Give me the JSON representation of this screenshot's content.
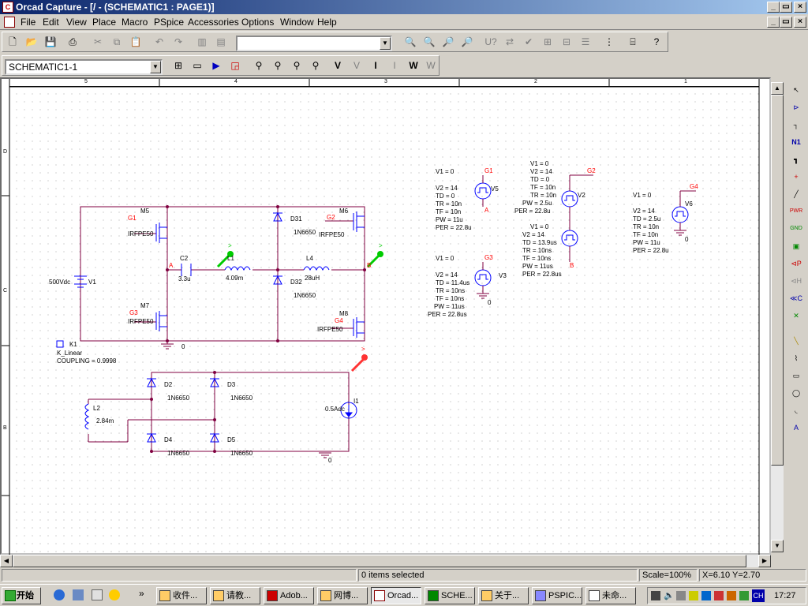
{
  "window": {
    "title": "Orcad Capture - [/ - (SCHEMATIC1 : PAGE1)]",
    "app_icon": "orcad-icon"
  },
  "menu": [
    "File",
    "Edit",
    "View",
    "Place",
    "Macro",
    "PSpice",
    "Accessories",
    "Options",
    "Window",
    "Help"
  ],
  "toolbar": {
    "part_combo_value": "",
    "schematic_combo_value": "SCHEMATIC1-1"
  },
  "ruler": [
    "5",
    "4",
    "3",
    "2",
    "1"
  ],
  "side_letters": [
    "D",
    "C",
    "B"
  ],
  "schematic": {
    "transistors": [
      {
        "ref": "M5",
        "part": "IRFPE50",
        "gate": "G1"
      },
      {
        "ref": "M6",
        "part": "IRFPE50",
        "gate": "G2"
      },
      {
        "ref": "M7",
        "part": "IRFPE50",
        "gate": "G3"
      },
      {
        "ref": "M8",
        "part": "IRFPE50",
        "gate": "G4"
      }
    ],
    "diodes": [
      {
        "ref": "D31",
        "part": "1N6650"
      },
      {
        "ref": "D32",
        "part": "1N6650"
      },
      {
        "ref": "D2",
        "part": "1N6650"
      },
      {
        "ref": "D3",
        "part": "1N6650"
      },
      {
        "ref": "D4",
        "part": "1N6650"
      },
      {
        "ref": "D5",
        "part": "1N6650"
      }
    ],
    "passives": [
      {
        "ref": "C2",
        "value": "3.3u"
      },
      {
        "ref": "L1",
        "value": "4.09m"
      },
      {
        "ref": "L4",
        "value": "28uH"
      },
      {
        "ref": "L2",
        "value": "2.84m"
      }
    ],
    "source_v1": {
      "ref": "V1",
      "value": "500Vdc"
    },
    "source_i1": {
      "ref": "I1",
      "value": "0.5Adc"
    },
    "coupling": {
      "ref": "K1",
      "model": "K_Linear",
      "text": "COUPLING = 0.9998"
    },
    "nodes": [
      "A",
      "B"
    ],
    "grounds": [
      "0",
      "0",
      "0",
      "0",
      "0"
    ],
    "pulses": [
      {
        "ref": "V5",
        "net": "G1",
        "lines": [
          "V1 = 0",
          "V2 = 14",
          "TD = 0",
          "TR = 10n",
          "TF = 10n",
          "PW = 11u",
          "PER = 22.8u"
        ],
        "bottom": "A"
      },
      {
        "ref": "V3",
        "net": "G3",
        "lines": [
          "V1 = 0",
          "V2 = 14",
          "TD = 11.4us",
          "TR = 10ns",
          "TF = 10ns",
          "PW = 11us",
          "PER = 22.8us"
        ],
        "bottom": "0"
      },
      {
        "ref": "V2",
        "net": "G2",
        "lines": [
          "V1 = 0",
          "V2 = 14",
          "TD = 0",
          "TF = 10n",
          "TR = 10n",
          "PW = 2.5u",
          "PER = 22.8u"
        ]
      },
      {
        "ref": "",
        "net": "B",
        "lines": [
          "V1 = 0",
          "V2 = 14",
          "TD = 13.9us",
          "TR = 10ns",
          "TF = 10ns",
          "PW = 11us",
          "PER = 22.8us"
        ]
      },
      {
        "ref": "V6",
        "net": "G4",
        "lines": [
          "V1 = 0",
          "V2 = 14",
          "TD = 2.5u",
          "TR = 10n",
          "TF = 10n",
          "PW = 11u",
          "PER = 22.8u"
        ],
        "bottom": "0"
      }
    ],
    "probe_marks": [
      ">",
      ">",
      ">"
    ]
  },
  "palette": [
    "select",
    "part",
    "wire",
    "net-alias",
    "bus",
    "junction",
    "bus-entry",
    "power",
    "ground",
    "hierarchical-block",
    "hier-port",
    "hier-pin",
    "off-page-connector",
    "no-connect",
    "line",
    "polyline",
    "rectangle",
    "ellipse",
    "arc",
    "text"
  ],
  "status": {
    "message": "0 items selected",
    "scale": "Scale=100%",
    "coords": "X=6.10  Y=2.70"
  },
  "taskbar": {
    "start": "开始",
    "tasks": [
      "收件...",
      "请教...",
      "Adob...",
      "网博...",
      "Orcad...",
      "SCHE...",
      "关于...",
      "PSPIC...",
      "未命..."
    ],
    "active_task": 4,
    "tray_lang": "CH",
    "clock": "17:27"
  },
  "colors": {
    "wire": "#800040",
    "part": "#0000ff",
    "text": "#000000",
    "net_alias": "#ff0000",
    "probe_green": "#00cc00",
    "probe_red": "#ff0000"
  }
}
